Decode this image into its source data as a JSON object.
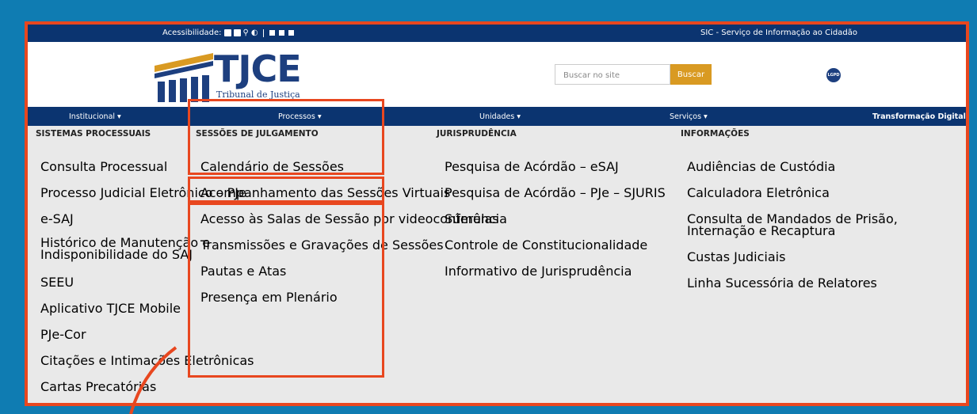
{
  "topbar": {
    "accessibility_label": "Acessibilidade:",
    "sic_link": "SIC - Serviço de Informação ao Cidadão"
  },
  "header": {
    "logo_text": "TJCE",
    "logo_subtitle": "Tribunal de Justiça",
    "search_placeholder": "Buscar no site",
    "search_button": "Buscar",
    "lgpd_badge": "LGPD"
  },
  "nav": {
    "items": [
      "Institucional  ▾",
      "Processos  ▾",
      "Unidades  ▾",
      "Serviços  ▾",
      "Transformação Digital"
    ]
  },
  "menu": {
    "col1": {
      "heading": "SISTEMAS PROCESSUAIS",
      "links": [
        "Consulta Processual",
        "Processo Judicial Eletrônico – PJe",
        "e-SAJ",
        "Histórico de Manutenção e",
        "Indisponibilidade do SAJ",
        "SEEU",
        "Aplicativo TJCE Mobile",
        "PJe-Cor",
        "Citações e Intimações Eletrônicas",
        "Cartas Precatórias"
      ]
    },
    "col2": {
      "heading": "SESSÕES DE JULGAMENTO",
      "links": [
        "Calendário de Sessões",
        "Acompanhamento das Sessões Virtuais",
        "Acesso às Salas de Sessão por videoconferência",
        "Transmissões e Gravações de Sessões",
        "Pautas e Atas",
        "Presença em Plenário"
      ]
    },
    "col3": {
      "heading": "JURISPRUDÊNCIA",
      "links": [
        "Pesquisa de Acórdão – eSAJ",
        "Pesquisa de Acórdão – PJe – SJURIS",
        "Súmulas",
        "Controle de Constitucionalidade",
        "Informativo de Jurisprudência"
      ]
    },
    "col4": {
      "heading": "INFORMAÇÕES",
      "links": [
        "Audiências de Custódia",
        "Calculadora Eletrônica",
        "Consulta de Mandados de Prisão,",
        "Internação e Recaptura",
        "Custas Judiciais",
        "Linha Sucessória de Relatores"
      ]
    }
  },
  "colors": {
    "background": "#0f7cb2",
    "frame": "#e8471f",
    "navy": "#0b3470",
    "search_button": "#d99a22",
    "menu_bg": "#e9e9e9"
  }
}
